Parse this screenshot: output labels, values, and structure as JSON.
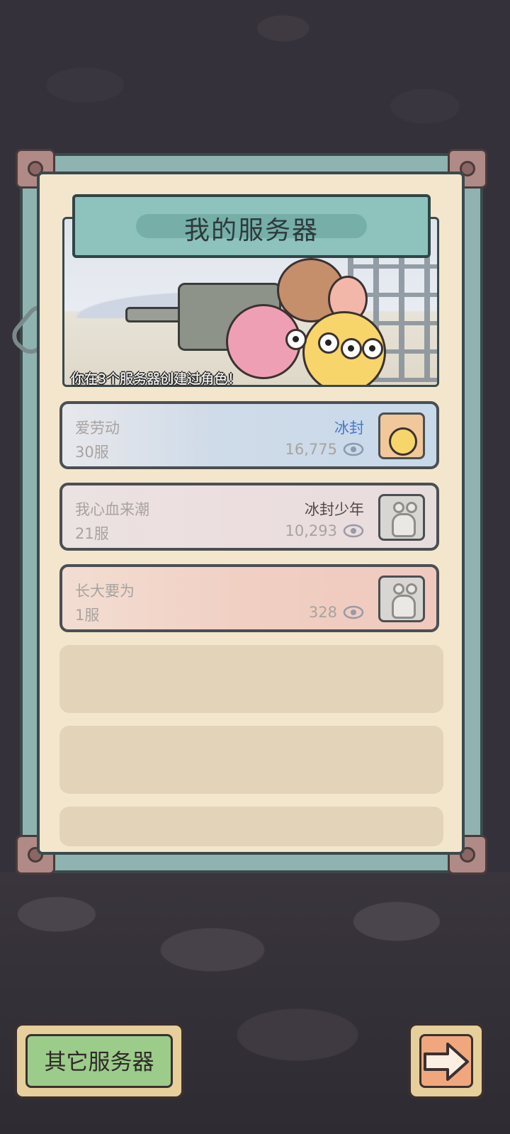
{
  "title": "我的服务器",
  "banner": {
    "caption": "你在3个服务器创建过角色！"
  },
  "servers": [
    {
      "name": "爱劳动",
      "server": "30服",
      "status": "冰封",
      "views": "16,775",
      "avatar": "chick-avatar",
      "status_color": "#4a78c8"
    },
    {
      "name": "我心血来潮",
      "server": "21服",
      "status": "冰封少年",
      "views": "10,293",
      "avatar": "snail-placeholder-avatar",
      "status_color": "#4f4a48"
    },
    {
      "name": "长大要为",
      "server": "1服",
      "status": "",
      "views": "328",
      "avatar": "snail-placeholder-avatar"
    }
  ],
  "buttons": {
    "other_servers": "其它服务器",
    "next": "arrow-right-icon"
  }
}
